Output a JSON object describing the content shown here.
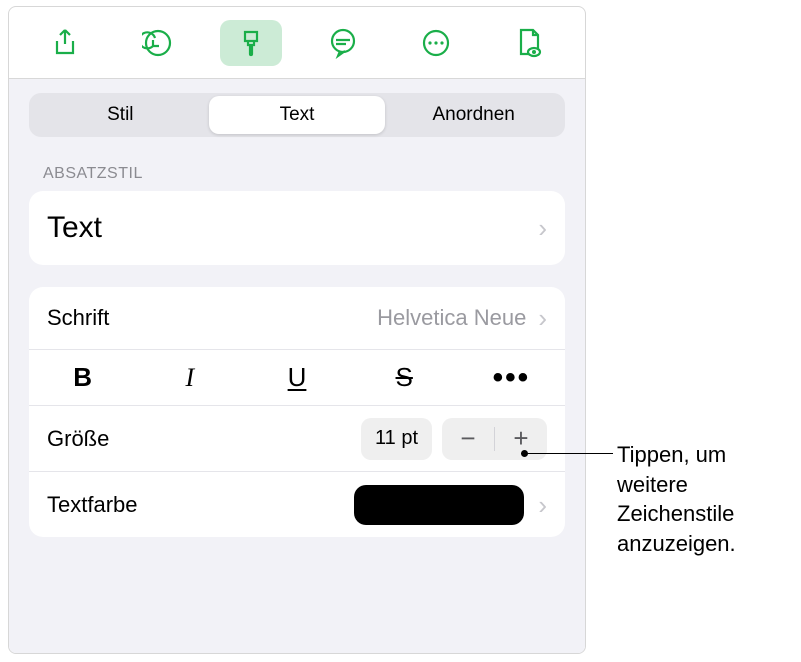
{
  "toolbar": {
    "share": "share-icon",
    "undo": "undo-icon",
    "format": "brush-icon",
    "comment": "speech-icon",
    "more": "ellipsis-icon",
    "document": "document-icon"
  },
  "tabs": {
    "style": "Stil",
    "text": "Text",
    "arrange": "Anordnen"
  },
  "sections": {
    "paragraph_style_label": "ABSATZSTIL"
  },
  "paragraph_style": {
    "value": "Text"
  },
  "font": {
    "label": "Schrift",
    "value": "Helvetica Neue"
  },
  "style_buttons": {
    "bold": "B",
    "italic": "I",
    "underline": "U",
    "strike": "S",
    "more": "•••"
  },
  "size": {
    "label": "Größe",
    "value": "11 pt",
    "minus": "−",
    "plus": "+"
  },
  "text_color": {
    "label": "Textfarbe",
    "swatch": "#000000"
  },
  "callout": {
    "text": "Tippen, um weitere Zeichenstile anzuzeigen."
  },
  "chevron": "›"
}
